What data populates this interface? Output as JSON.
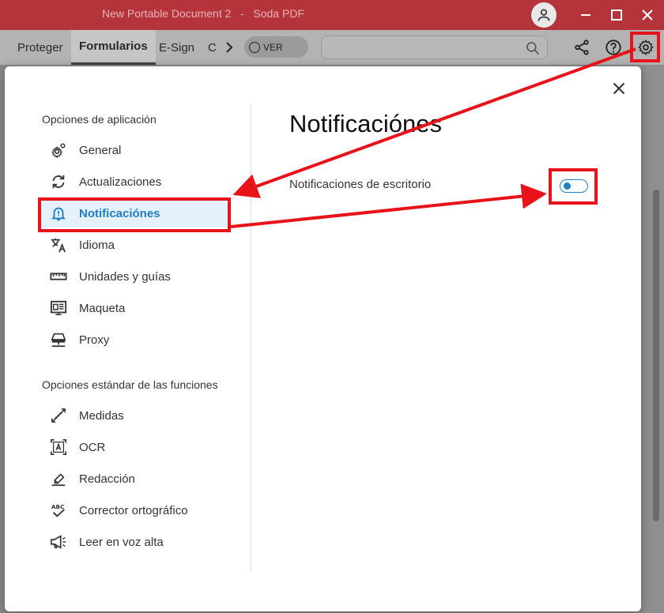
{
  "window": {
    "title": "New Portable Document 2   -   Soda PDF"
  },
  "toolbar": {
    "tabs": [
      "Proteger",
      "Formularios",
      "E-Sign",
      "C"
    ],
    "active_tab": "Formularios",
    "ver_label": "VER",
    "search_placeholder": ""
  },
  "dialog": {
    "sections": [
      {
        "title": "Opciones de aplicación",
        "items": [
          {
            "label": "General",
            "icon": "gear-icon"
          },
          {
            "label": "Actualizaciones",
            "icon": "sync-icon"
          },
          {
            "label": "Notificaciónes",
            "icon": "bell-icon",
            "active": true
          },
          {
            "label": "Idioma",
            "icon": "translate-icon"
          },
          {
            "label": "Unidades y guías",
            "icon": "ruler-icon"
          },
          {
            "label": "Maqueta",
            "icon": "layout-icon"
          },
          {
            "label": "Proxy",
            "icon": "network-icon"
          }
        ]
      },
      {
        "title": "Opciones estándar de las funciones",
        "items": [
          {
            "label": "Medidas",
            "icon": "measure-icon"
          },
          {
            "label": "OCR",
            "icon": "ocr-icon"
          },
          {
            "label": "Redacción",
            "icon": "eraser-icon"
          },
          {
            "label": "Corrector ortográfico",
            "icon": "spellcheck-icon"
          },
          {
            "label": "Leer en voz alta",
            "icon": "megaphone-icon"
          }
        ]
      }
    ],
    "panel": {
      "title": "Notificaciónes",
      "setting_label": "Notificaciones de escritorio",
      "setting_enabled": false
    }
  },
  "colors": {
    "titlebar": "#b5343c",
    "accent": "#1d7dc5",
    "annotation": "#e8121a"
  }
}
